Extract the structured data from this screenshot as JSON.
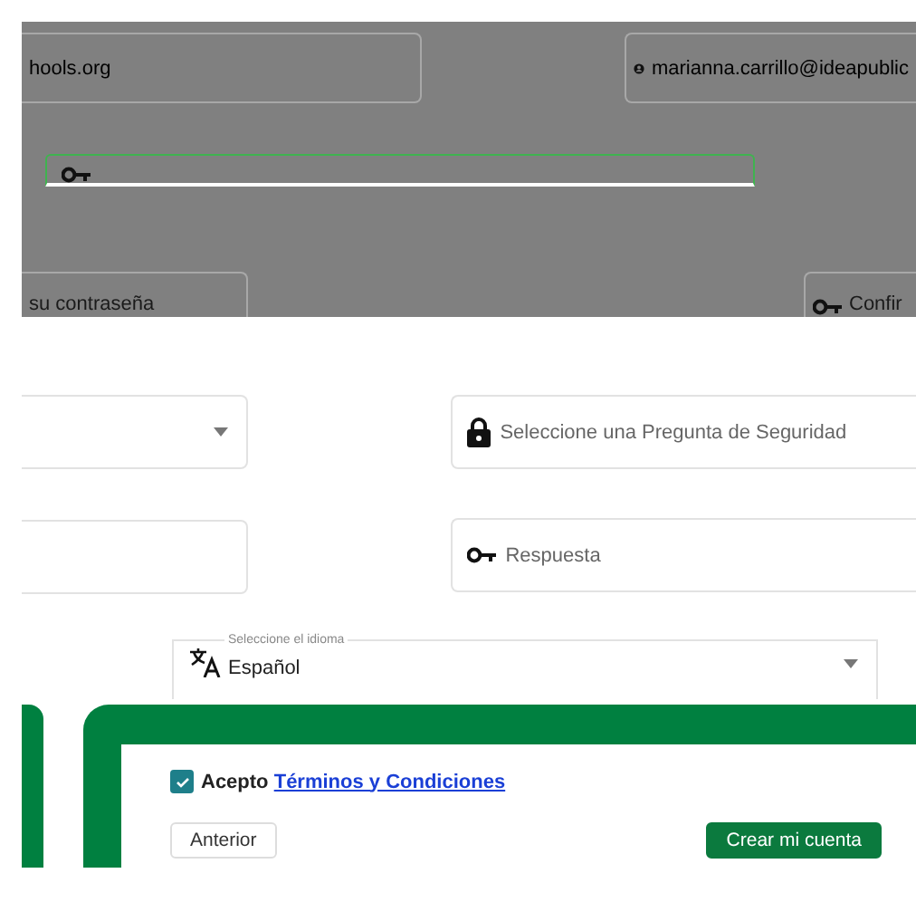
{
  "account_fields": [
    {
      "kind": "text",
      "value": "hools.org"
    },
    {
      "kind": "user",
      "value": "marianna.carrillo@ideapublic"
    }
  ],
  "password_fields": [
    {
      "kind": "plain",
      "placeholder": "su contraseña"
    },
    {
      "kind": "key",
      "placeholder": "Confir"
    }
  ],
  "left_fields": [
    {
      "kind": "select"
    },
    {
      "kind": "input"
    }
  ],
  "security_fields": [
    {
      "kind": "lock",
      "placeholder": "Seleccione una Pregunta de Seguridad"
    },
    {
      "kind": "key",
      "placeholder": "Respuesta"
    }
  ],
  "language": {
    "label": "Seleccione el idioma",
    "value": "Español"
  },
  "terms": {
    "checked": true,
    "text": "Acepto",
    "link": "Términos y Condiciones"
  },
  "buttons": [
    {
      "kind": "secondary",
      "label": "Anterior"
    },
    {
      "kind": "primary",
      "label": "Crear mi cuenta"
    }
  ]
}
